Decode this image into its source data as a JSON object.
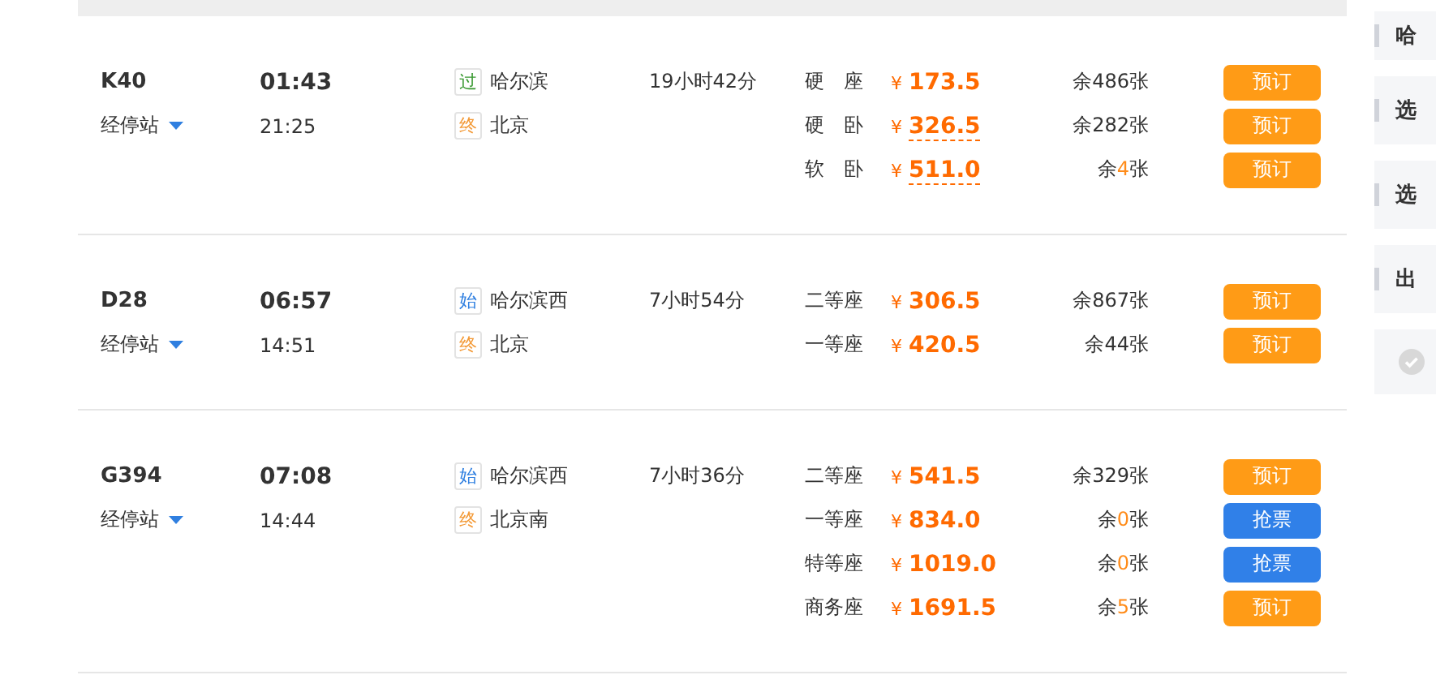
{
  "trains": [
    {
      "number": "K40",
      "stops_label": "经停站",
      "depart": "01:43",
      "arrive": "21:25",
      "from": {
        "kind": "pass",
        "mark": "过",
        "name": "哈尔滨"
      },
      "to": {
        "kind": "end",
        "mark": "终",
        "name": "北京"
      },
      "duration": "19小时42分",
      "seats": [
        {
          "type": "硬　座",
          "currency": "¥",
          "price": "173.5",
          "dashed": false,
          "remaining": {
            "before": "余",
            "count": "486",
            "after": "张",
            "scarce": false
          },
          "button": {
            "kind": "book",
            "label": "预订"
          }
        },
        {
          "type": "硬　卧",
          "currency": "¥",
          "price": "326.5",
          "dashed": true,
          "remaining": {
            "before": "余",
            "count": "282",
            "after": "张",
            "scarce": false
          },
          "button": {
            "kind": "book",
            "label": "预订"
          }
        },
        {
          "type": "软　卧",
          "currency": "¥",
          "price": "511.0",
          "dashed": true,
          "remaining": {
            "before": "余",
            "count": "4",
            "after": "张",
            "scarce": true
          },
          "button": {
            "kind": "book",
            "label": "预订"
          }
        }
      ]
    },
    {
      "number": "D28",
      "stops_label": "经停站",
      "depart": "06:57",
      "arrive": "14:51",
      "from": {
        "kind": "start",
        "mark": "始",
        "name": "哈尔滨西"
      },
      "to": {
        "kind": "end",
        "mark": "终",
        "name": "北京"
      },
      "duration": "7小时54分",
      "seats": [
        {
          "type": "二等座",
          "currency": "¥",
          "price": "306.5",
          "dashed": false,
          "remaining": {
            "before": "余",
            "count": "867",
            "after": "张",
            "scarce": false
          },
          "button": {
            "kind": "book",
            "label": "预订"
          }
        },
        {
          "type": "一等座",
          "currency": "¥",
          "price": "420.5",
          "dashed": false,
          "remaining": {
            "before": "余",
            "count": "44",
            "after": "张",
            "scarce": false
          },
          "button": {
            "kind": "book",
            "label": "预订"
          }
        }
      ]
    },
    {
      "number": "G394",
      "stops_label": "经停站",
      "depart": "07:08",
      "arrive": "14:44",
      "from": {
        "kind": "start",
        "mark": "始",
        "name": "哈尔滨西"
      },
      "to": {
        "kind": "end",
        "mark": "终",
        "name": "北京南"
      },
      "duration": "7小时36分",
      "seats": [
        {
          "type": "二等座",
          "currency": "¥",
          "price": "541.5",
          "dashed": false,
          "remaining": {
            "before": "余",
            "count": "329",
            "after": "张",
            "scarce": false
          },
          "button": {
            "kind": "book",
            "label": "预订"
          }
        },
        {
          "type": "一等座",
          "currency": "¥",
          "price": "834.0",
          "dashed": false,
          "remaining": {
            "before": "余",
            "count": "0",
            "after": "张",
            "scarce": true
          },
          "button": {
            "kind": "grab",
            "label": "抢票"
          }
        },
        {
          "type": "特等座",
          "currency": "¥",
          "price": "1019.0",
          "dashed": false,
          "remaining": {
            "before": "余",
            "count": "0",
            "after": "张",
            "scarce": true
          },
          "button": {
            "kind": "grab",
            "label": "抢票"
          }
        },
        {
          "type": "商务座",
          "currency": "¥",
          "price": "1691.5",
          "dashed": false,
          "remaining": {
            "before": "余",
            "count": "5",
            "after": "张",
            "scarce": true
          },
          "button": {
            "kind": "book",
            "label": "预订"
          }
        }
      ]
    }
  ],
  "sidebar": {
    "filters": [
      {
        "kind": "title",
        "label": "哈"
      },
      {
        "kind": "title",
        "label": "选"
      },
      {
        "kind": "title",
        "label": "选"
      },
      {
        "kind": "title",
        "label": "出"
      },
      {
        "kind": "check",
        "checked": false
      }
    ]
  }
}
